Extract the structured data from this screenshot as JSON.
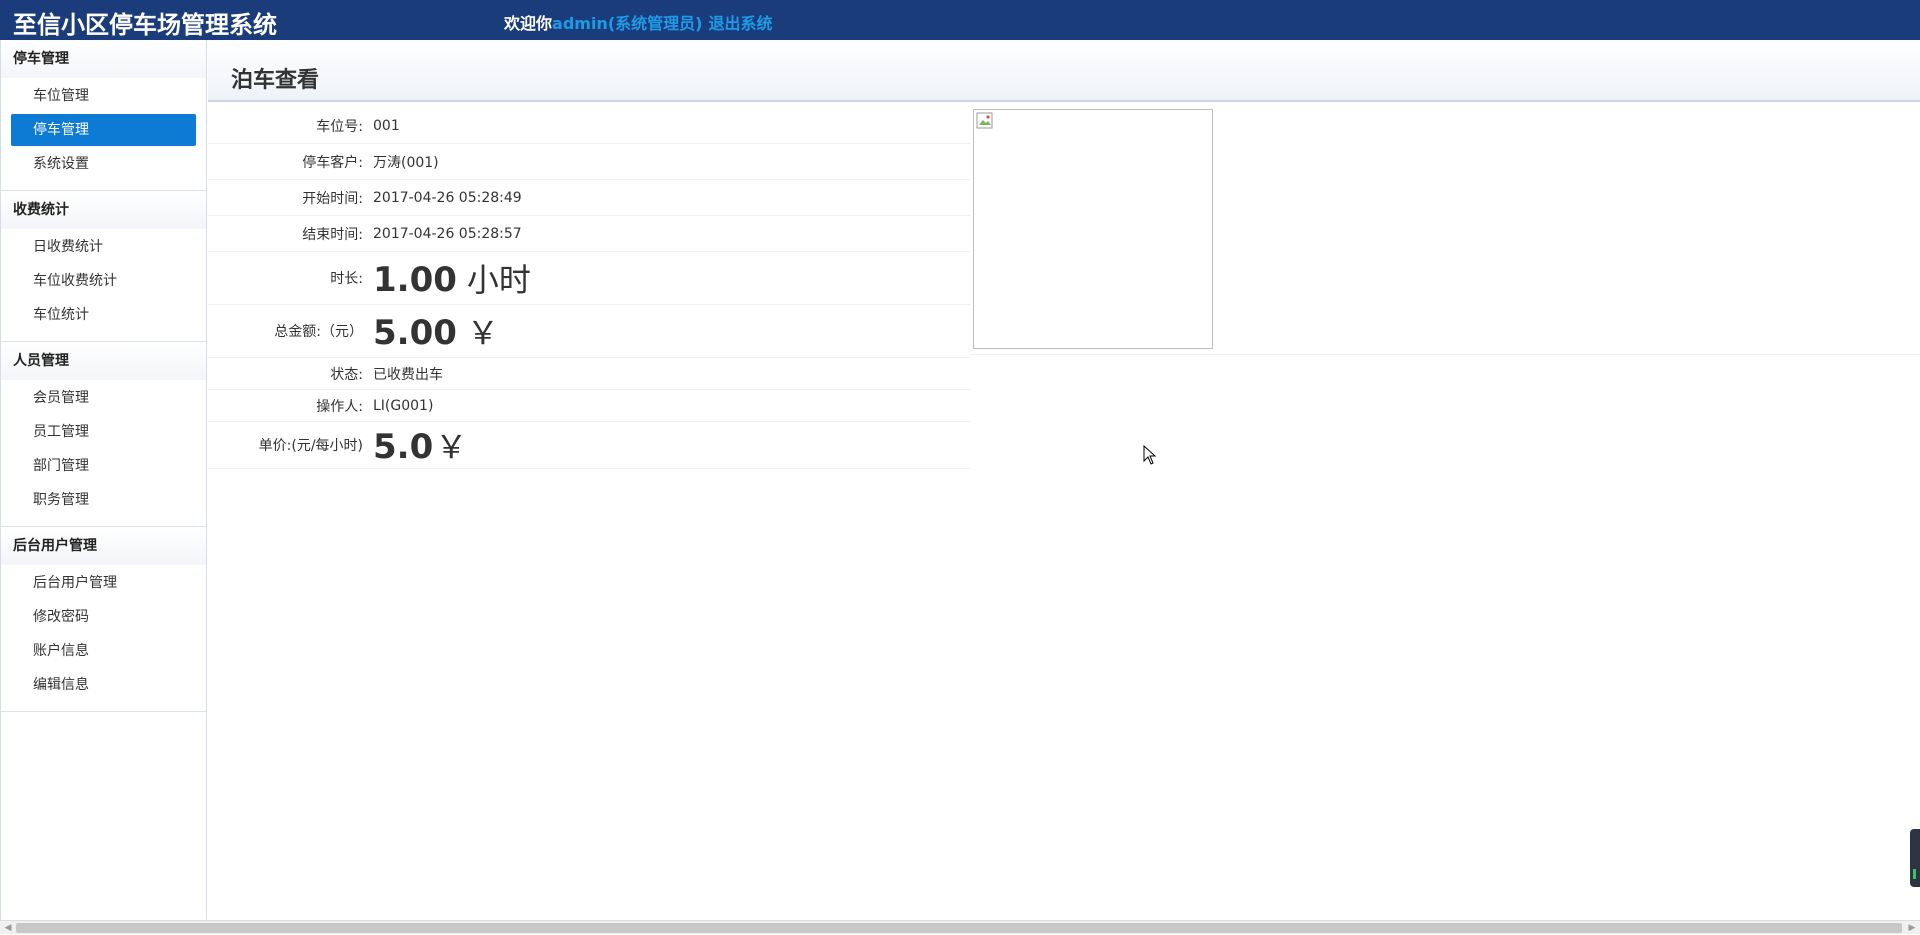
{
  "header": {
    "app_title": "至信小区停车场管理系统",
    "welcome_prefix": "欢迎你",
    "user": "admin",
    "role": "(系统管理员)",
    "logout": "退出系统"
  },
  "sidebar": {
    "sections": [
      {
        "title": "停车管理",
        "items": [
          "车位管理",
          "停车管理",
          "系统设置"
        ],
        "active": 1
      },
      {
        "title": "收费统计",
        "items": [
          "日收费统计",
          "车位收费统计",
          "车位统计"
        ]
      },
      {
        "title": "人员管理",
        "items": [
          "会员管理",
          "员工管理",
          "部门管理",
          "职务管理"
        ]
      },
      {
        "title": "后台用户管理",
        "items": [
          "后台用户管理",
          "修改密码",
          "账户信息",
          "编辑信息"
        ]
      }
    ]
  },
  "page": {
    "title": "泊车查看"
  },
  "detail": {
    "space_no_label": "车位号:",
    "space_no": "001",
    "customer_label": "停车客户:",
    "customer": "万涛(001)",
    "start_label": "开始时间:",
    "start": "2017-04-26 05:28:49",
    "end_label": "结束时间:",
    "end": "2017-04-26 05:28:57",
    "duration_label": "时长:",
    "duration_value": "1.00",
    "duration_unit": "小时",
    "total_label": "总金额:（元）",
    "total_value": "5.00",
    "total_unit": "￥",
    "status_label": "状态:",
    "status": "已收费出车",
    "operator_label": "操作人:",
    "operator": "LI(G001)",
    "price_label": "单价:(元/每小时)",
    "price_value": "5.0",
    "price_unit": "￥"
  },
  "colors": {
    "header_bg": "#1b3c7a",
    "active_item": "#0d7bd4",
    "link": "#1e9be6"
  }
}
